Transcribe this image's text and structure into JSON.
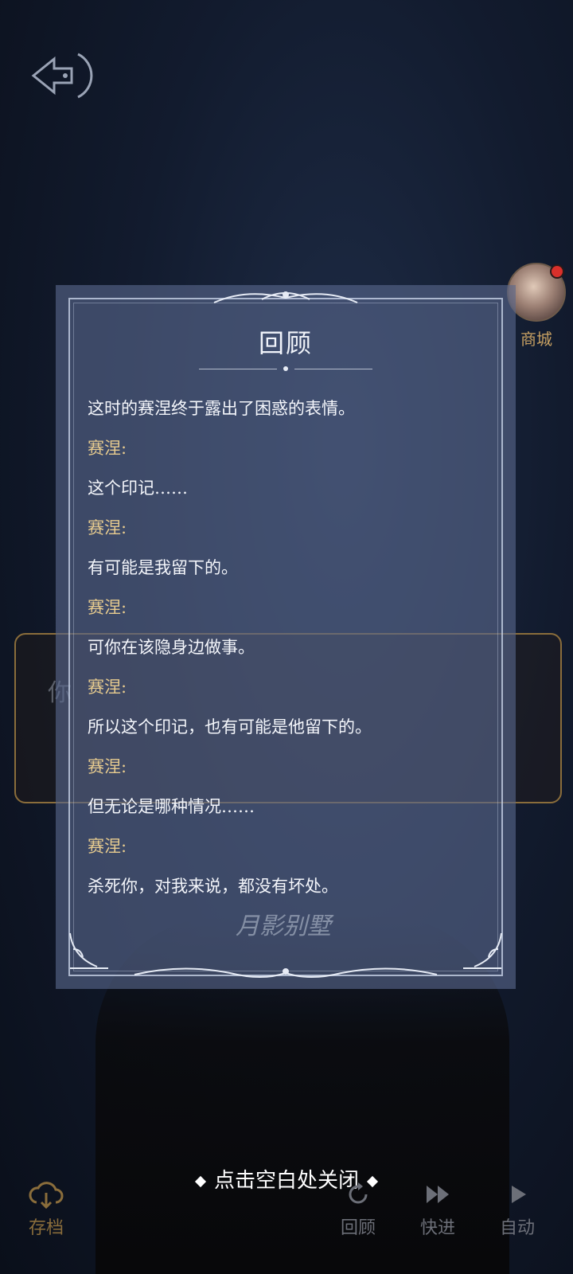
{
  "panel": {
    "title": "回顾",
    "log": [
      {
        "type": "narration",
        "text": "这时的赛涅终于露出了困惑的表情。"
      },
      {
        "type": "speaker",
        "text": "赛涅:"
      },
      {
        "type": "line",
        "text": "这个印记……"
      },
      {
        "type": "speaker",
        "text": "赛涅:"
      },
      {
        "type": "line",
        "text": "有可能是我留下的。"
      },
      {
        "type": "speaker",
        "text": "赛涅:"
      },
      {
        "type": "line",
        "text": "可你在该隐身边做事。"
      },
      {
        "type": "speaker",
        "text": "赛涅:"
      },
      {
        "type": "line",
        "text": "所以这个印记，也有可能是他留下的。"
      },
      {
        "type": "speaker",
        "text": "赛涅:"
      },
      {
        "type": "line",
        "text": "但无论是哪种情况……"
      },
      {
        "type": "speaker",
        "text": "赛涅:"
      },
      {
        "type": "line",
        "text": "杀死你，对我来说，都没有坏处。"
      }
    ],
    "watermark": "月影别墅"
  },
  "background": {
    "dialog_partial_text": "你"
  },
  "store": {
    "label": "商城",
    "has_notification": true
  },
  "close_hint": "点击空白处关闭",
  "bottom_bar": {
    "save_label": "存档",
    "review_label": "回顾",
    "skip_label": "快进",
    "auto_label": "自动"
  },
  "colors": {
    "panel_bg": "#58688c",
    "speaker_text": "#e8cc8f",
    "gold_accent": "#8a6d3b",
    "notification": "#d9302b"
  },
  "icons": {
    "back": "back-arrow-icon",
    "save": "cloud-download-icon",
    "review": "rewind-icon",
    "skip": "fast-forward-icon",
    "auto": "play-icon"
  }
}
